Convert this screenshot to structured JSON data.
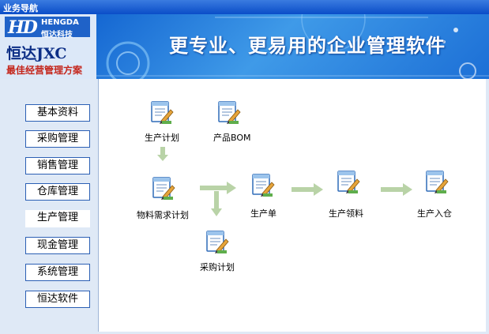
{
  "window": {
    "title": "业务导航"
  },
  "banner": {
    "logo_en": "HENGDA",
    "logo_cn": "恒达科技",
    "logo_mark": "HD",
    "product_name": "恒达JXC",
    "product_slogan": "最佳经营管理方案",
    "slogan": "更专业、更易用的企业管理软件"
  },
  "sidebar": {
    "items": [
      {
        "label": "基本资料"
      },
      {
        "label": "采购管理"
      },
      {
        "label": "销售管理"
      },
      {
        "label": "仓库管理"
      },
      {
        "label": "生产管理"
      },
      {
        "label": "现金管理"
      },
      {
        "label": "系统管理"
      },
      {
        "label": "恒达软件"
      }
    ],
    "active_item": "生产管理"
  },
  "workflow": {
    "nodes": [
      {
        "label": "生产计划",
        "icon": "document-pencil-icon"
      },
      {
        "label": "产品BOM",
        "icon": "document-pencil-icon"
      },
      {
        "label": "物料需求计划",
        "icon": "document-pencil-icon"
      },
      {
        "label": "生产单",
        "icon": "document-pencil-icon"
      },
      {
        "label": "生产领料",
        "icon": "document-pencil-icon"
      },
      {
        "label": "生产入仓",
        "icon": "document-pencil-icon"
      },
      {
        "label": "采购计划",
        "icon": "document-pencil-icon"
      }
    ]
  },
  "colors": {
    "title_bar": "#0a4dc8",
    "banner_blue": "#1f6fd8",
    "sidebar_bg": "#dfe9f6",
    "nav_border": "#2b5fb4",
    "arrow": "#b9d3a7",
    "slogan_red": "#c4251b"
  }
}
